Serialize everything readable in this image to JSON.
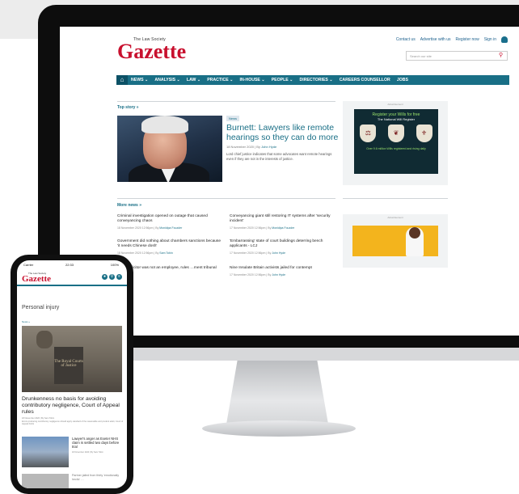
{
  "desktop": {
    "top_links": [
      "Contact us",
      "Advertise with us",
      "Register now",
      "Sign in"
    ],
    "logo": {
      "small": "The Law Society",
      "main": "Gazette"
    },
    "search_placeholder": "Search our site",
    "nav": [
      "NEWS ⌄",
      "ANALYSIS ⌄",
      "LAW ⌄",
      "PRACTICE ⌄",
      "IN-HOUSE ⌄",
      "PEOPLE ⌄",
      "DIRECTORIES ⌄",
      "CAREERS COUNSELLOR",
      "JOBS"
    ],
    "top_story": {
      "label": "Top story »",
      "badge": "News",
      "headline": "Burnett: Lawyers like remote hearings so they can do more",
      "meta_date": "18 November 2020",
      "meta_author": "John Hyde",
      "standfirst": "Lord chief justice indicates that some advocates want remote hearings even if they are not in the interests of justice."
    },
    "more_news_label": "More news »",
    "more_news": [
      {
        "title": "Criminal investigation opened on outage that caused conveyancing chaos",
        "date": "18 November 2020 12:56pm",
        "author": "Monidipa Fouzder"
      },
      {
        "title": "Conveyancing giant still restoring IT systems after 'security incident'",
        "date": "17 November 2020 12:56pm",
        "author": "Monidipa Fouzder"
      },
      {
        "title": "Government did nothing about chambers sanctions because 'it needs Chinese dosh'",
        "date": "18 November 2020 12:56pm",
        "author": "Sam Tobin"
      },
      {
        "title": "'Embarrassing' state of court buildings deterring bench applicants - LCJ",
        "date": "17 November 2020 12:56pm",
        "author": "John Hyde"
      },
      {
        "title": "…ant solicitor was not an employee, rules …ment tribunal",
        "date": "",
        "author": ""
      },
      {
        "title": "Nine Insulate Britain activists jailed for contempt",
        "date": "17 November 2020 12:56pm",
        "author": "John Hyde"
      }
    ],
    "ads": {
      "label": "Advertisement",
      "will_title": "Register your Wills for free",
      "will_sub": "The National Will Register",
      "shields": [
        "Protect",
        "Protect",
        "Protect"
      ],
      "will_foot": "Over 9.6 million Wills registered and rising daily",
      "will_brand": "certainty"
    }
  },
  "phone": {
    "status_left": "Carrier",
    "status_time": "22:33",
    "status_right": "100%",
    "logo_small": "The Law Society",
    "logo_main": "Gazette",
    "section": "Personal injury",
    "news_label": "News »",
    "image_sign": "The Royal Courts of Justice",
    "headline": "Drunkenness no basis for avoiding contributory negligence, Court of Appeal rules",
    "meta": "18 November 2020 | By Sam Tobin",
    "excerpt": "Errors producing contributory negligence should apply standard of the reasonable and prudent adult, Court of Appeal holds",
    "side_headline": "Lawyer's anger as Exeter NHS claim is settled two days before trial",
    "side_meta": "18 November 2020 | By Sam Tobin",
    "side2": "Partner jailed from thirty 'emotionally hectic' …"
  }
}
